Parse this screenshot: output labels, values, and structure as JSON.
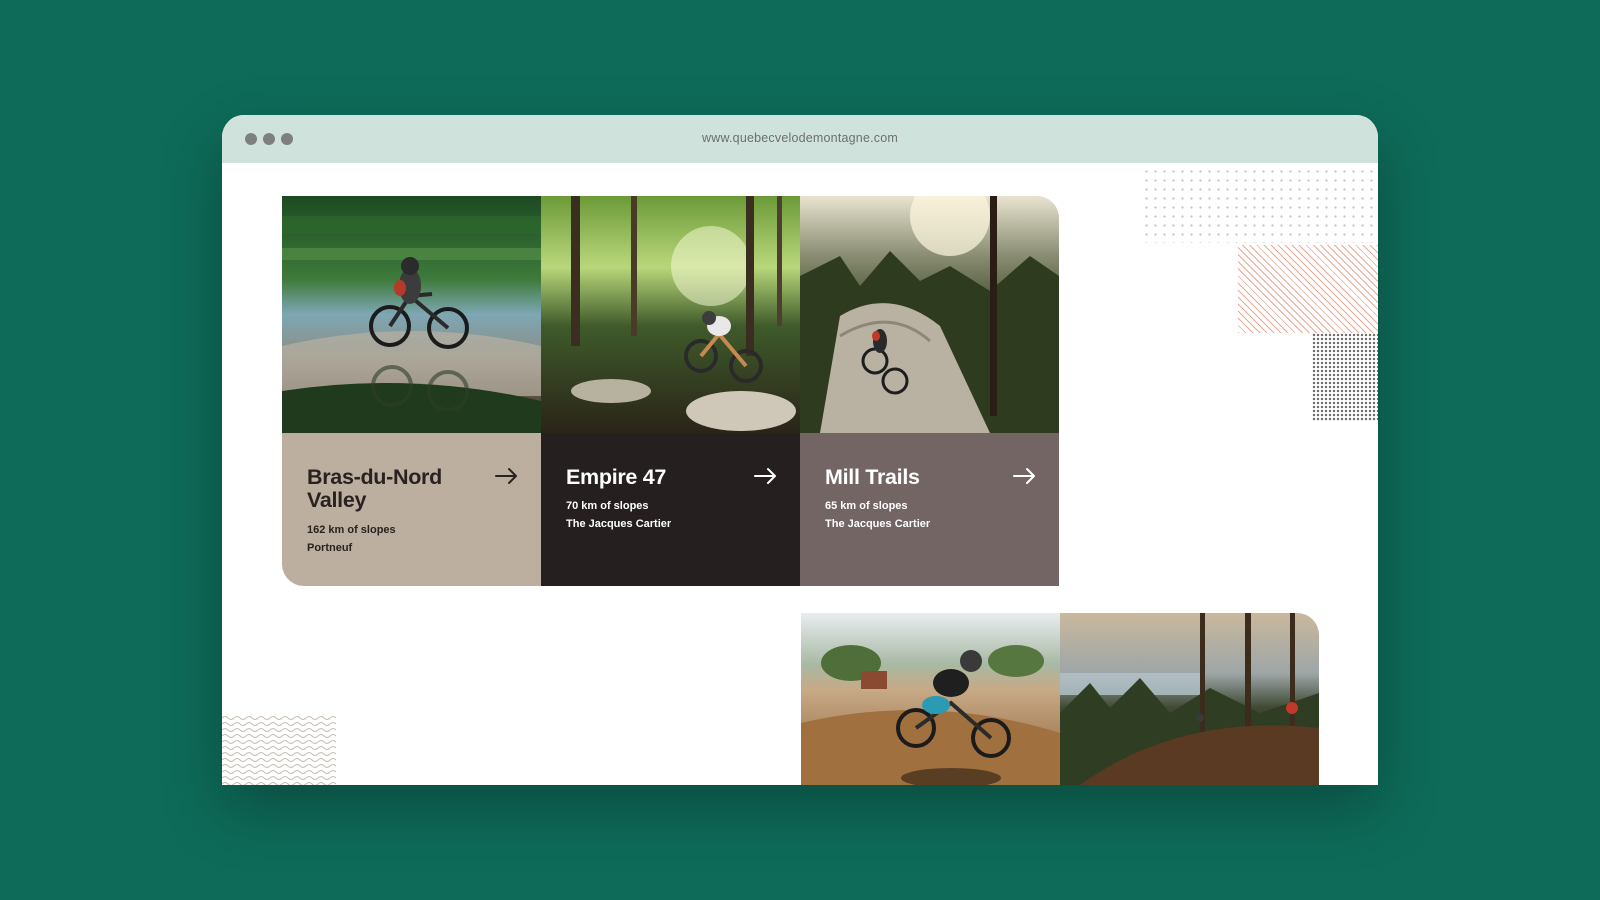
{
  "browser": {
    "url": "www.quebecvelodemontagne.com",
    "window_dots": [
      "close",
      "minimize",
      "maximize"
    ]
  },
  "trails": [
    {
      "name": "Bras-du-Nord Valley",
      "distance": "162 km of slopes",
      "region": "Portneuf",
      "color": "#bcaf9f"
    },
    {
      "name": "Empire 47",
      "distance": "70 km of slopes",
      "region": "The Jacques Cartier",
      "color": "#261f20"
    },
    {
      "name": "Mill Trails",
      "distance": "65 km of slopes",
      "region": "The Jacques Cartier",
      "color": "#726564"
    }
  ],
  "icons": {
    "card_arrow": "arrow-right-icon"
  },
  "colors": {
    "background": "#0e6b59",
    "titlebar": "#cfe3dc"
  }
}
